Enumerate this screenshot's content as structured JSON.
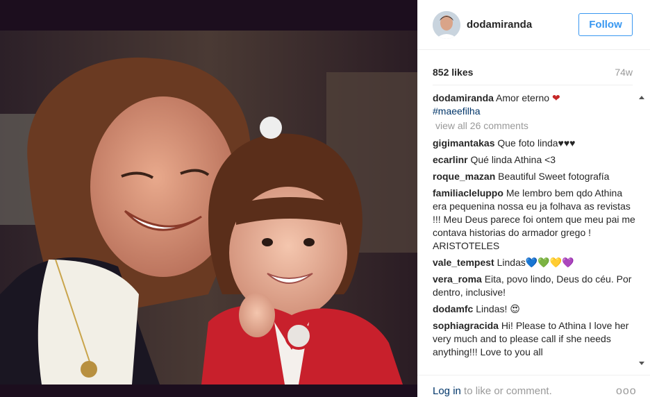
{
  "post": {
    "username": "dodamiranda",
    "follow_label": "Follow",
    "likes": "852 likes",
    "age": "74w",
    "caption_user": "dodamiranda",
    "caption_text": "Amor eterno",
    "caption_emoji": "❤",
    "hashtag": "#maeefilha",
    "view_all": "view all 26 comments"
  },
  "comments": [
    {
      "user": "gigimantakas",
      "text": "Que foto linda♥♥♥"
    },
    {
      "user": "ecarlinr",
      "text": "Qué linda Athina <3"
    },
    {
      "user": "roque_mazan",
      "text": "Beautiful Sweet fotografía"
    },
    {
      "user": "familiacleluppo",
      "text": "Me lembro bem qdo Athina era pequenina nossa eu ja folhava as revistas !!! Meu Deus parece foi ontem que meu pai me contava historias do armador grego ! ARISTOTELES"
    },
    {
      "user": "vale_tempest",
      "text": "Lindas💙💚💛💜"
    },
    {
      "user": "vera_roma",
      "text": "Eita, povo lindo, Deus do céu. Por dentro, inclusive!"
    },
    {
      "user": "dodamfc",
      "text": "Lindas! 😍"
    },
    {
      "user": "sophiagracida",
      "text": "Hi! Please to Athina I love her very much and to please call if she needs anything!!! Love to you all"
    }
  ],
  "footer": {
    "login_link": "Log in",
    "login_rest": " to like or comment.",
    "more": "ooo"
  },
  "colors": {
    "accent": "#3897f0",
    "link": "#003569",
    "muted": "#999999",
    "heart": "#c62828"
  },
  "icons": {
    "more": "more-options-icon",
    "scroll_up": "scroll-up-icon",
    "scroll_down": "scroll-down-icon"
  }
}
